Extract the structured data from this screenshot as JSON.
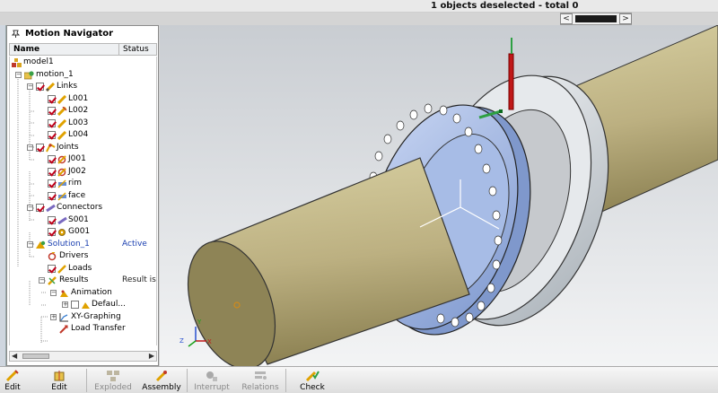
{
  "status_bar": {
    "message": "1 objects deselected  - total 0"
  },
  "hscroll": {
    "left": "<",
    "right": ">"
  },
  "navigator": {
    "title": "Motion Navigator",
    "col_name": "Name",
    "col_status": "Status",
    "tree": [
      {
        "label": "model1"
      },
      {
        "label": "motion_1"
      },
      {
        "label": "Links"
      },
      {
        "label": "L001"
      },
      {
        "label": "L002"
      },
      {
        "label": "L003"
      },
      {
        "label": "L004"
      },
      {
        "label": "Joints"
      },
      {
        "label": "J001"
      },
      {
        "label": "J002"
      },
      {
        "label": "rim"
      },
      {
        "label": "face"
      },
      {
        "label": "Connectors"
      },
      {
        "label": "S001"
      },
      {
        "label": "G001"
      },
      {
        "label": "Solution_1",
        "status": "Active"
      },
      {
        "label": "Drivers"
      },
      {
        "label": "Loads"
      },
      {
        "label": "Results",
        "status": "Result is"
      },
      {
        "label": "Animation"
      },
      {
        "label": "Defaul..."
      },
      {
        "label": "XY-Graphing"
      },
      {
        "label": "Load Transfer"
      }
    ]
  },
  "viewport": {
    "triad": {
      "z": "Z",
      "x": "X",
      "y": "Y"
    }
  },
  "toolbar": [
    {
      "label": "Edit",
      "disabled": false
    },
    {
      "label": "Edit",
      "disabled": false
    },
    {
      "label": "Exploded",
      "disabled": true
    },
    {
      "label": "Assembly",
      "disabled": false
    },
    {
      "label": "Interrupt",
      "disabled": true
    },
    {
      "label": "Relations",
      "disabled": true
    },
    {
      "label": "Check",
      "disabled": false
    }
  ]
}
